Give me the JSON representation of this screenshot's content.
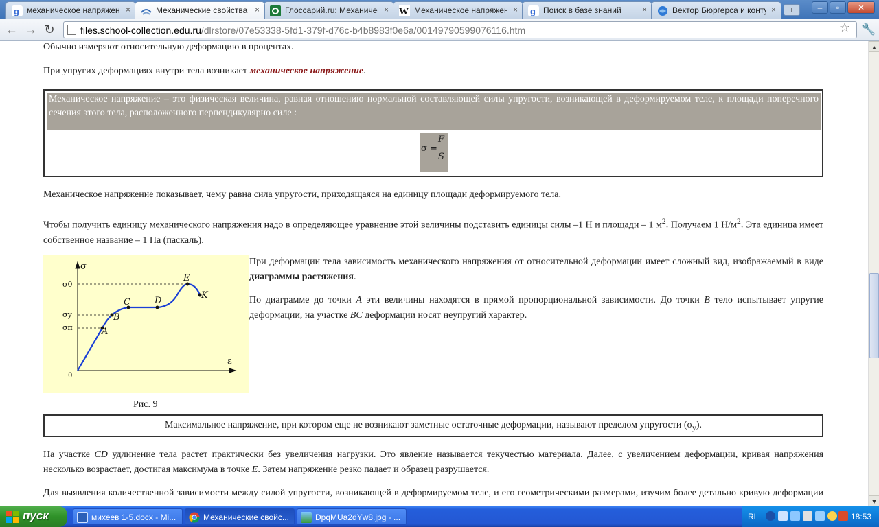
{
  "browser": {
    "tabs": [
      {
        "title": "механическое напряжение",
        "icon": "google-icon"
      },
      {
        "title": "Механические свойства тв",
        "icon": "school-collection-icon",
        "active": true
      },
      {
        "title": "Глоссарий.ru: Механическо",
        "icon": "glossary-icon"
      },
      {
        "title": "Механическое напряжение",
        "icon": "wikipedia-icon"
      },
      {
        "title": "Поиск в базе знаний",
        "icon": "google-icon"
      },
      {
        "title": "Вектор Бюргерса и контур",
        "icon": "globe-icon"
      }
    ],
    "new_tab_label": "+",
    "close_glyph": "×",
    "url_host": "files.school-collection.edu.ru",
    "url_path": "/dlrstore/07e53338-5fd1-379f-d76c-b4b8983f0e6a/00149790599076116.htm"
  },
  "article": {
    "p_percent": "Обычно измеряют относительную деформацию в процентах.",
    "p_stress_intro": "При упругих деформациях внутри тела возникает ",
    "p_stress_term": "механическое напряжение",
    "definition": "Механическое напряжение – это физическая величина, равная отношению нормальной составляющей силы упругости, возникающей в деформируемом теле, к площади поперечного сечения этого тела, расположенного перпендикулярно силе :",
    "formula": {
      "lhs": "σ =",
      "numerator": "F",
      "denominator": "S"
    },
    "p_shows": "Механическое напряжение показывает, чему равна сила упругости, приходящаяся на единицу площади деформируемого тела.",
    "p_unit_a": "Чтобы получить единицу механического напряжения надо в определяющее уравнение этой величины подставить единицы силы –1 Н и площади – 1 м",
    "p_unit_b": ". Получаем 1 Н/м",
    "p_unit_c": ". Эта единица имеет собственное название – 1 Па (паскаль).",
    "sup2": "2",
    "p_diagram_a": "При деформации тела зависимость механического напряжения от относительной деформации имеет сложный вид, изображаемый в виде ",
    "p_diagram_bold": "диаграммы растяжения",
    "p_points_a": "По диаграмме до точки ",
    "p_points_b": " эти величины находятся в прямой пропорциональной зависимости. До точки ",
    "p_points_c": " тело испытывает упругие деформации, на участке ",
    "p_points_d": " деформации носят неупругий характер.",
    "pt_A": "A",
    "pt_B": "B",
    "seg_BC": "BC",
    "figure_caption": "Рис. 9",
    "limit_text": "Максимальное напряжение, при котором еще не возникают заметные остаточные деформации, называют пределом упругости (σ",
    "limit_sub": "у",
    "limit_end": ").",
    "p_cd_a": "На участке ",
    "seg_CD": "CD",
    "p_cd_b": " удлинение тела растет практически без увеличения нагрузки. Это явление называется текучестью материала. Далее, с увеличением деформации, кривая напряжения несколько возрастает, достигая максимума в точке ",
    "pt_E": "E",
    "p_cd_c": ". Затем напряжение резко падает и образец разрушается.",
    "p_last": "Для выявления количественной зависимости между силой упругости, возникающей в деформируемом теле, и его геометрическими размерами, изучим более детально кривую деформации различных тел."
  },
  "diagram": {
    "axis_y": "σ",
    "axis_x": "ε",
    "origin": "0",
    "sigma_0": "σ0",
    "sigma_y": "σу",
    "sigma_p": "σп",
    "points": [
      "A",
      "B",
      "C",
      "D",
      "E",
      "K"
    ],
    "curve_color": "#1a3fd6"
  },
  "taskbar": {
    "start_label": "пуск",
    "tasks": [
      {
        "label": "михеев 1-5.docx - Mi...",
        "icon": "word-icon"
      },
      {
        "label": "Механические свойс...",
        "icon": "chrome-icon",
        "active": true
      },
      {
        "label": "DpqMUa2dYw8.jpg - ...",
        "icon": "image-viewer-icon"
      }
    ],
    "lang": "RL",
    "clock": "18:53"
  }
}
